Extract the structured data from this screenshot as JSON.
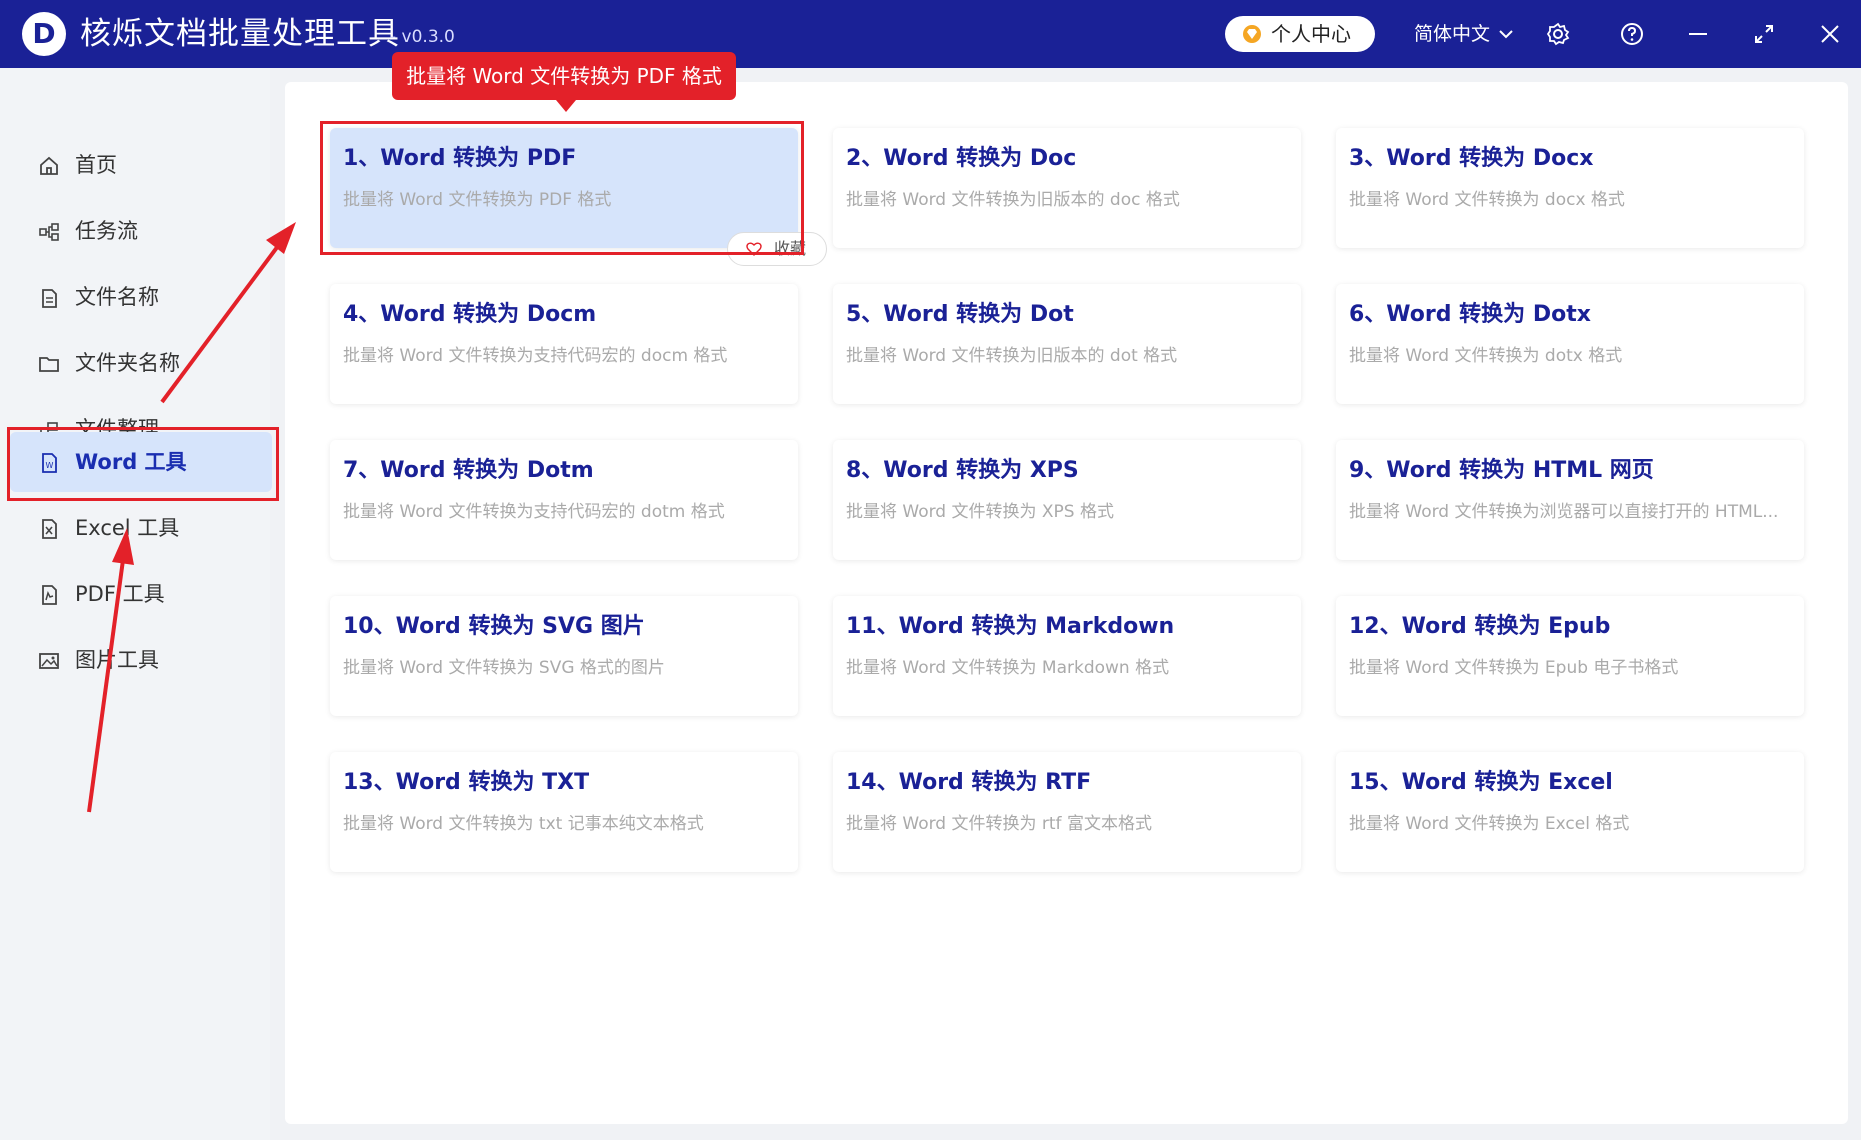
{
  "app": {
    "title": "核烁文档批量处理工具",
    "version": "- v0.3.0",
    "logo_letter": "D"
  },
  "titlebar": {
    "user_center": "个人中心",
    "language": "简体中文",
    "icons": [
      "gem-icon",
      "chevron-down-icon",
      "settings-icon",
      "help-icon",
      "minimize-icon",
      "maximize-icon",
      "close-icon"
    ]
  },
  "sidebar": {
    "items": [
      {
        "label": "首页",
        "icon": "home-icon"
      },
      {
        "label": "任务流",
        "icon": "workflow-icon"
      },
      {
        "label": "文件名称",
        "icon": "file-name-icon"
      },
      {
        "label": "文件夹名称",
        "icon": "folder-icon"
      },
      {
        "label": "文件整理",
        "icon": "organize-icon"
      },
      {
        "label": "Word 工具",
        "icon": "word-file-icon",
        "active": true
      },
      {
        "label": "Excel 工具",
        "icon": "excel-file-icon"
      },
      {
        "label": "PDF 工具",
        "icon": "pdf-file-icon"
      },
      {
        "label": "图片工具",
        "icon": "image-icon"
      }
    ]
  },
  "tooltip": "批量将 Word 文件转换为 PDF 格式",
  "favorite_label": "收藏",
  "cards": [
    {
      "title": "1、Word 转换为 PDF",
      "desc": "批量将 Word 文件转换为 PDF 格式",
      "active": true
    },
    {
      "title": "2、Word 转换为 Doc",
      "desc": "批量将 Word 文件转换为旧版本的 doc 格式"
    },
    {
      "title": "3、Word 转换为 Docx",
      "desc": "批量将 Word 文件转换为 docx 格式"
    },
    {
      "title": "4、Word 转换为 Docm",
      "desc": "批量将 Word 文件转换为支持代码宏的 docm 格式"
    },
    {
      "title": "5、Word 转换为 Dot",
      "desc": "批量将 Word 文件转换为旧版本的 dot 格式"
    },
    {
      "title": "6、Word 转换为 Dotx",
      "desc": "批量将 Word 文件转换为 dotx 格式"
    },
    {
      "title": "7、Word 转换为 Dotm",
      "desc": "批量将 Word 文件转换为支持代码宏的 dotm 格式"
    },
    {
      "title": "8、Word 转换为 XPS",
      "desc": "批量将 Word 文件转换为 XPS 格式"
    },
    {
      "title": "9、Word 转换为 HTML 网页",
      "desc": "批量将 Word 文件转换为浏览器可以直接打开的 HTML..."
    },
    {
      "title": "10、Word 转换为 SVG 图片",
      "desc": "批量将 Word 文件转换为 SVG 格式的图片"
    },
    {
      "title": "11、Word 转换为 Markdown",
      "desc": "批量将 Word 文件转换为 Markdown 格式"
    },
    {
      "title": "12、Word 转换为 Epub",
      "desc": "批量将 Word 文件转换为 Epub 电子书格式"
    },
    {
      "title": "13、Word 转换为 TXT",
      "desc": "批量将 Word 文件转换为 txt 记事本纯文本格式"
    },
    {
      "title": "14、Word 转换为 RTF",
      "desc": "批量将 Word 文件转换为 rtf 富文本格式"
    },
    {
      "title": "15、Word 转换为 Excel",
      "desc": "批量将 Word 文件转换为 Excel 格式"
    }
  ],
  "colors": {
    "titlebar": "#1a2196",
    "active_bg": "#d6e4fb",
    "card_title": "#1a2196",
    "annotation_red": "#e32129"
  }
}
